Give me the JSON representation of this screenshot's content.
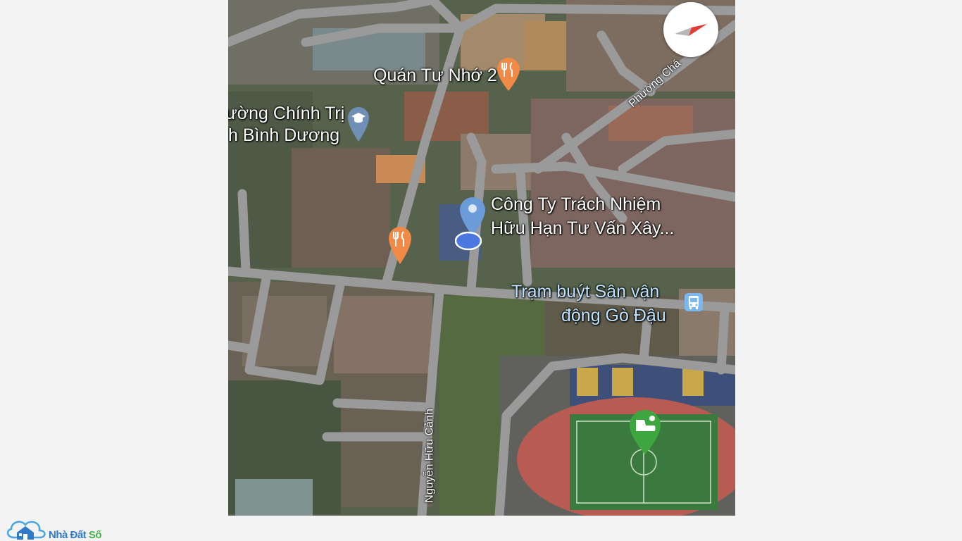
{
  "map": {
    "labels": {
      "restaurant": "Quán Tư Nhớ 2",
      "school_line1": "ường Chính Trị",
      "school_line2": "h Bình Dương",
      "company_line1": "Công Ty Trách Nhiệm",
      "company_line2": "Hữu Hạn Tư Vấn Xây...",
      "bus_line1": "Trạm buýt Sân vận",
      "bus_line2": "động Gò Đậu",
      "street_nguyen": "Nguyễn Hữu Cảnh",
      "street_phuong": "Phường Chá"
    },
    "icons": {
      "restaurant_pin_top": "restaurant-icon",
      "restaurant_pin_left": "restaurant-icon",
      "school_pin": "school-icon",
      "location_pin": "location-pin-icon",
      "current_location": "current-location-dot-icon",
      "bus_stop": "bus-icon",
      "stadium_pin": "stadium-icon",
      "compass": "compass-icon"
    },
    "colors": {
      "restaurant_pin": "#f08a46",
      "school_pin": "#6f8fb5",
      "location_pin": "#6b9bd8",
      "bus_icon": "#79b8f0",
      "stadium_pin": "#3ea63f",
      "road": "#9a9a9a",
      "compass_needle": "#e53935"
    }
  },
  "brand": {
    "name_part1": "Nhà Đất ",
    "name_part2": "Số",
    "logo_icon": "house-cloud-icon"
  }
}
